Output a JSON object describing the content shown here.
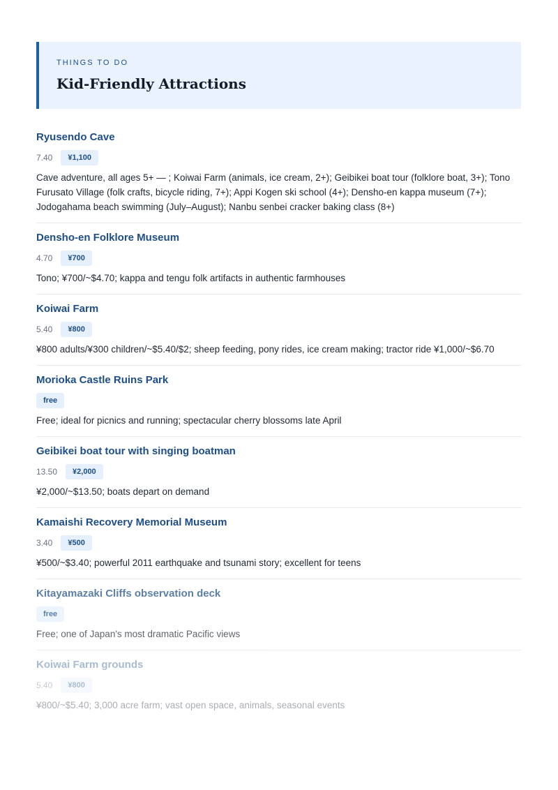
{
  "header": {
    "eyebrow": "THINGS TO DO",
    "title": "Kid-Friendly Attractions"
  },
  "items": [
    {
      "name": "Ryusendo Cave",
      "score": "7.40",
      "badge": "¥1,100",
      "description": "Cave adventure, all ages 5+ — ; Koiwai Farm (animals, ice cream, 2+); Geibikei boat tour (folklore boat, 3+); Tono Furusato Village (folk crafts, bicycle riding, 7+); Appi Kogen ski school (4+); Densho-en kappa museum (7+); Jodogahama beach swimming (July–August); Nanbu senbei cracker baking class (8+)",
      "opacity": 1
    },
    {
      "name": "Densho-en Folklore Museum",
      "score": "4.70",
      "badge": "¥700",
      "description": "Tono; ¥700/~$4.70; kappa and tengu folk artifacts in authentic farmhouses",
      "opacity": 1
    },
    {
      "name": "Koiwai Farm",
      "score": "5.40",
      "badge": "¥800",
      "description": "¥800 adults/¥300 children/~$5.40/$2; sheep feeding, pony rides, ice cream making; tractor ride ¥1,000/~$6.70",
      "opacity": 1
    },
    {
      "name": "Morioka Castle Ruins Park",
      "score": "",
      "badge": "free",
      "description": "Free; ideal for picnics and running; spectacular cherry blossoms late April",
      "opacity": 1
    },
    {
      "name": "Geibikei boat tour with singing boatman",
      "score": "13.50",
      "badge": "¥2,000",
      "description": "¥2,000/~$13.50; boats depart on demand",
      "opacity": 1
    },
    {
      "name": "Kamaishi Recovery Memorial Museum",
      "score": "3.40",
      "badge": "¥500",
      "description": "¥500/~$3.40; powerful 2011 earthquake and tsunami story; excellent for teens",
      "opacity": 1
    },
    {
      "name": "Kitayamazaki Cliffs observation deck",
      "score": "",
      "badge": "free",
      "description": "Free; one of Japan's most dramatic Pacific views",
      "opacity": 0.72
    },
    {
      "name": "Koiwai Farm grounds",
      "score": "5.40",
      "badge": "¥800",
      "description": "¥800/~$5.40; 3,000 acre farm; vast open space, animals, seasonal events",
      "opacity": 0.38
    }
  ]
}
